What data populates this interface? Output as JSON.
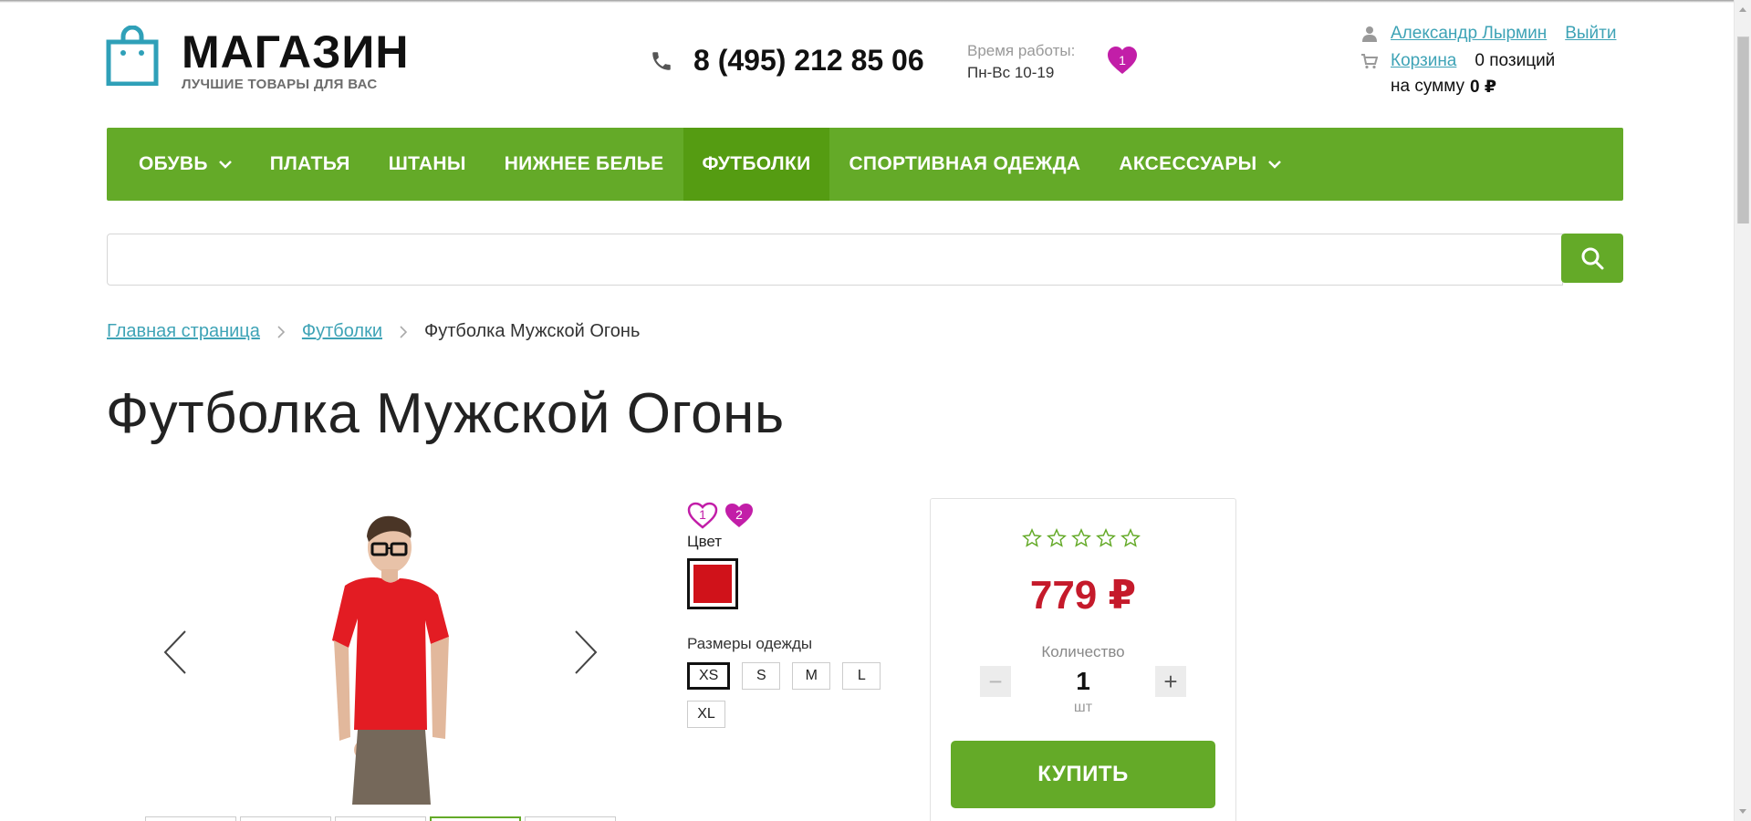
{
  "header": {
    "logo_title": "МАГАЗИН",
    "logo_subtitle": "ЛУЧШИЕ ТОВАРЫ ДЛЯ ВАС",
    "phone": "8 (495) 212 85 06",
    "hours_label": "Время работы:",
    "hours_value": "Пн-Вс 10-19",
    "favorites_count": "1",
    "user_name": "Александр Лырмин",
    "logout": "Выйти",
    "cart_link": "Корзина",
    "cart_items": "0 позиций",
    "cart_sum_label": "на сумму",
    "cart_sum_value": "0 ₽"
  },
  "nav": {
    "items": [
      {
        "label": "ОБУВЬ",
        "dropdown": true,
        "active": false
      },
      {
        "label": "ПЛАТЬЯ",
        "dropdown": false,
        "active": false
      },
      {
        "label": "ШТАНЫ",
        "dropdown": false,
        "active": false
      },
      {
        "label": "НИЖНЕЕ БЕЛЬЕ",
        "dropdown": false,
        "active": false
      },
      {
        "label": "ФУТБОЛКИ",
        "dropdown": false,
        "active": true
      },
      {
        "label": "СПОРТИВНАЯ ОДЕЖДА",
        "dropdown": false,
        "active": false
      },
      {
        "label": "АКСЕССУАРЫ",
        "dropdown": true,
        "active": false
      }
    ]
  },
  "search": {
    "value": "",
    "placeholder": ""
  },
  "breadcrumb": {
    "home": "Главная страница",
    "category": "Футболки",
    "current": "Футболка Мужской Огонь"
  },
  "product": {
    "title": "Футболка Мужской Огонь",
    "compare_count": "1",
    "favorite_count": "2",
    "color_label": "Цвет",
    "selected_color": "#d0121a",
    "sizes_label": "Размеры одежды",
    "sizes": [
      "XS",
      "S",
      "M",
      "L",
      "XL"
    ],
    "selected_size": "XS",
    "rating_stars": 0,
    "price": "779 ₽",
    "quantity_label": "Количество",
    "quantity": "1",
    "unit": "шт",
    "buy_label": "КУПИТЬ"
  },
  "colors": {
    "accent": "#64aa28",
    "accent_active": "#559c12",
    "link": "#3ea3b6",
    "price": "#c51a2b",
    "badge": "#c21ea8"
  }
}
